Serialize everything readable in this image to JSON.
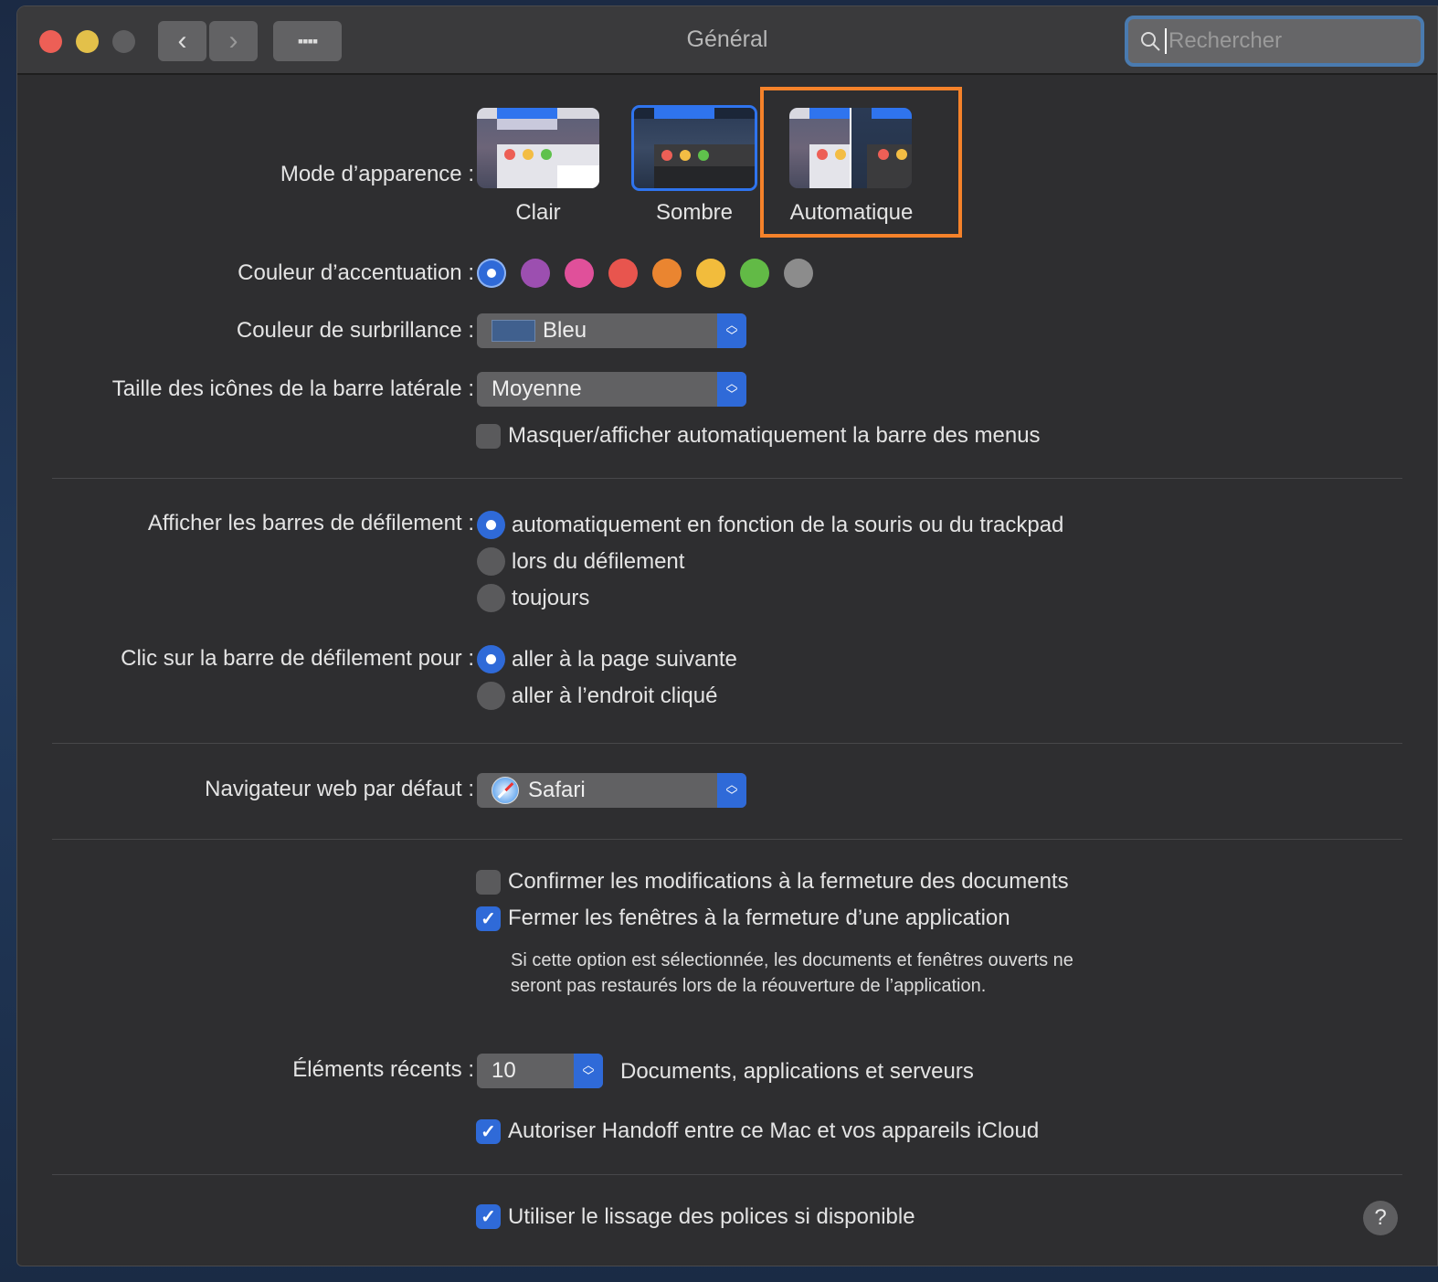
{
  "window": {
    "title": "Général",
    "search_placeholder": "Rechercher"
  },
  "appearance": {
    "label": "Mode d’apparence :",
    "options": [
      {
        "label": "Clair"
      },
      {
        "label": "Sombre",
        "selected": true
      },
      {
        "label": "Automatique",
        "highlighted": true
      }
    ]
  },
  "accent": {
    "label": "Couleur d’accentuation :",
    "colors": [
      "#2f6ad8",
      "#9c4fb0",
      "#e0509a",
      "#e8554e",
      "#ea8530",
      "#f2bc3c",
      "#62ba46",
      "#8c8c8c"
    ],
    "selected": 0
  },
  "highlight": {
    "label": "Couleur de surbrillance :",
    "value": "Bleu",
    "swatch": "#40608e"
  },
  "sidebar_size": {
    "label": "Taille des icônes de la barre latérale :",
    "value": "Moyenne"
  },
  "menubar": {
    "label": "Masquer/afficher automatiquement la barre des menus",
    "checked": false
  },
  "scrollbars": {
    "label": "Afficher les barres de défilement :",
    "options": [
      "automatiquement en fonction de la souris ou du trackpad",
      "lors du défilement",
      "toujours"
    ],
    "selected": 0
  },
  "click_scroll": {
    "label": "Clic sur la barre de défilement pour :",
    "options": [
      "aller à la page suivante",
      "aller à l’endroit cliqué"
    ],
    "selected": 0
  },
  "browser": {
    "label": "Navigateur web par défaut :",
    "value": "Safari"
  },
  "confirm_changes": {
    "label": "Confirmer les modifications à la fermeture des documents",
    "checked": false
  },
  "close_windows": {
    "label": "Fermer les fenêtres à la fermeture d’une application",
    "checked": true,
    "note": "Si cette option est sélectionnée, les documents et fenêtres ouverts ne seront pas restaurés lors de la réouverture de l’application."
  },
  "recent": {
    "label": "Éléments récents :",
    "value": "10",
    "suffix": "Documents, applications et serveurs"
  },
  "handoff": {
    "label": "Autoriser Handoff entre ce Mac et vos appareils iCloud",
    "checked": true
  },
  "font_smoothing": {
    "label": "Utiliser le lissage des polices si disponible",
    "checked": true
  },
  "help": {
    "label": "?"
  }
}
